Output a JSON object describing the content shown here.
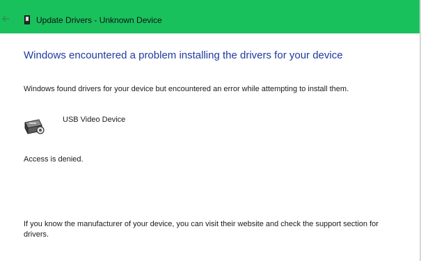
{
  "window": {
    "title": "Update Drivers - Unknown Device",
    "titlebar_color": "#19c15d",
    "heading_color": "#1e3b9e"
  },
  "icons": {
    "back": "back-arrow-icon",
    "title": "device-manager-icon",
    "device": "webcam-icon"
  },
  "content": {
    "heading": "Windows encountered a problem installing the drivers for your device",
    "description": "Windows found drivers for your device but encountered an error while attempting to install them.",
    "device_name": "USB Video Device",
    "error_message": "Access is denied.",
    "help_text": "If you know the manufacturer of your device, you can visit their website and check the support section for drivers."
  }
}
